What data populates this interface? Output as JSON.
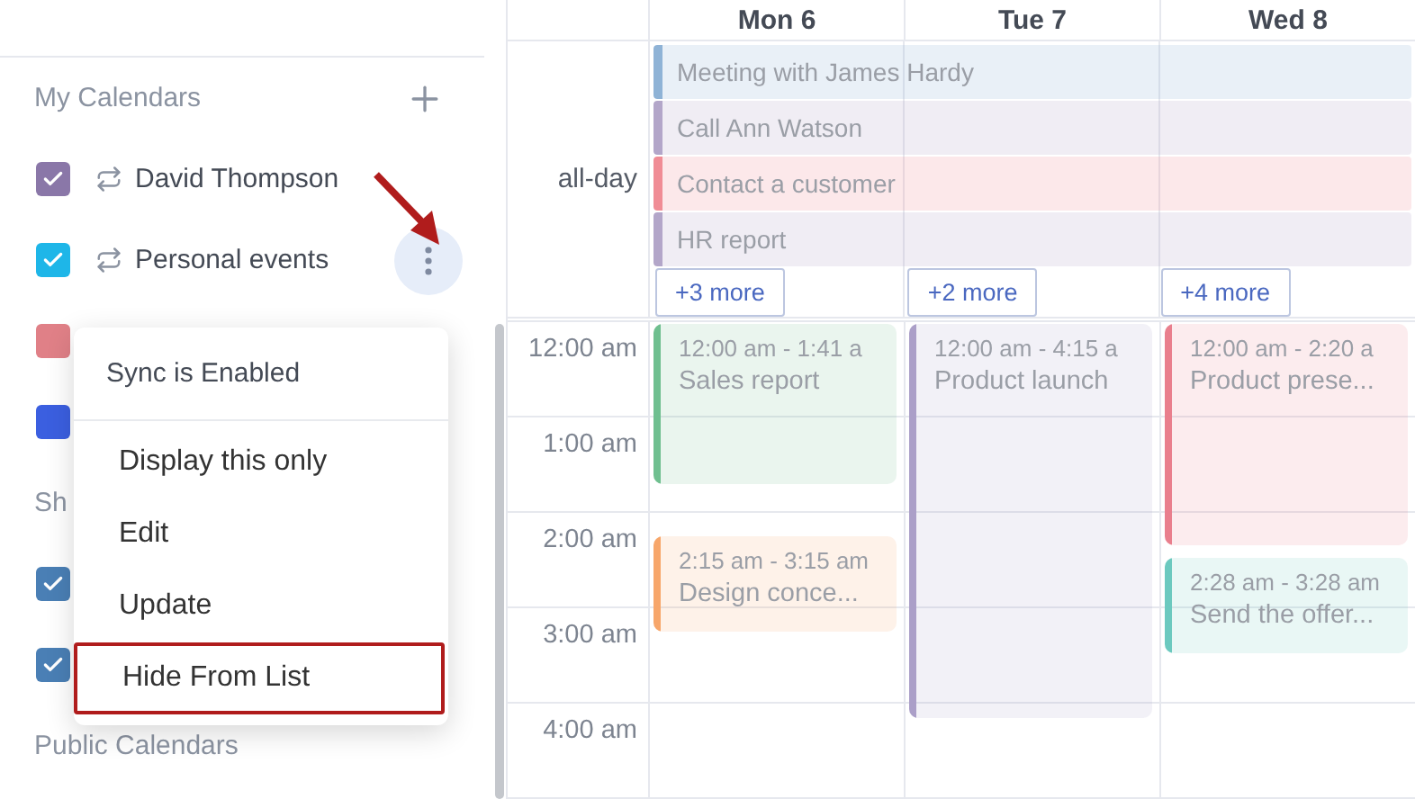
{
  "sidebar": {
    "sections": [
      {
        "title": "My Calendars",
        "add": true,
        "calendars": [
          {
            "name": "David Thompson",
            "color": "#8a77a8",
            "checked": true,
            "sync": true,
            "active": false
          },
          {
            "name": "Personal events",
            "color": "#1eb6e8",
            "checked": true,
            "sync": true,
            "active": true
          },
          {
            "color": "#e08087",
            "checked": false
          },
          {
            "color": "#3b5fe0",
            "checked": false
          }
        ]
      },
      {
        "title": "Sh",
        "add": false,
        "calendars": [
          {
            "color": "#4a7fb5",
            "checked": true
          },
          {
            "color": "#4a7fb5",
            "checked": true
          }
        ]
      },
      {
        "title": "Public Calendars",
        "add": false
      }
    ]
  },
  "menu": {
    "header": "Sync is Enabled",
    "items": [
      {
        "label": "Display this only",
        "highlighted": false
      },
      {
        "label": "Edit",
        "highlighted": false
      },
      {
        "label": "Update",
        "highlighted": false
      },
      {
        "label": "Hide From List",
        "highlighted": true
      }
    ]
  },
  "calendar": {
    "days": [
      {
        "label": "Mon 6",
        "more": "+3 more",
        "events": [
          {
            "time": "12:00 am - 1:41 a",
            "title": "Sales report",
            "color": "#6fbf8f"
          },
          {
            "time": "2:15 am - 3:15 am",
            "title": "Design conce...",
            "color": "#f7a66a"
          }
        ]
      },
      {
        "label": "Tue 7",
        "more": "+2 more",
        "events": [
          {
            "time": "12:00 am - 4:15 a",
            "title": "Product launch",
            "color": "#ab9fc8"
          }
        ]
      },
      {
        "label": "Wed 8",
        "more": "+4 more",
        "events": [
          {
            "time": "12:00 am - 2:20 a",
            "title": "Product prese...",
            "color": "#e97f8d"
          },
          {
            "time": "2:28 am - 3:28 am",
            "title": "Send the offer...",
            "color": "#6cc9bf"
          }
        ]
      }
    ],
    "all_day": {
      "label": "all-day",
      "events": [
        {
          "title": "Meeting with James Hardy",
          "color": "#8fb3d6"
        },
        {
          "title": "Call Ann Watson",
          "color": "#b3a6c9"
        },
        {
          "title": "Contact a customer",
          "color": "#f08c95"
        },
        {
          "title": "HR report",
          "color": "#b3a6c9"
        }
      ]
    },
    "times": [
      "12:00 am",
      "1:00 am",
      "2:00 am",
      "3:00 am",
      "4:00 am"
    ]
  }
}
